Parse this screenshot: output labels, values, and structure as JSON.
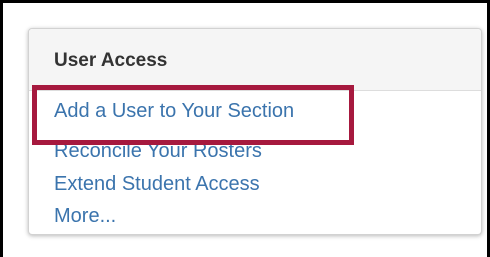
{
  "panel": {
    "title": "User Access",
    "links": [
      {
        "label": "Add a User to Your Section"
      },
      {
        "label": "Reconcile Your Rosters"
      },
      {
        "label": "Extend Student Access"
      },
      {
        "label": "More..."
      }
    ]
  },
  "colors": {
    "link": "#3b74ad",
    "title": "#333333",
    "header_bg": "#f5f5f5",
    "highlight": "#a6193e",
    "frame": "#000000"
  }
}
